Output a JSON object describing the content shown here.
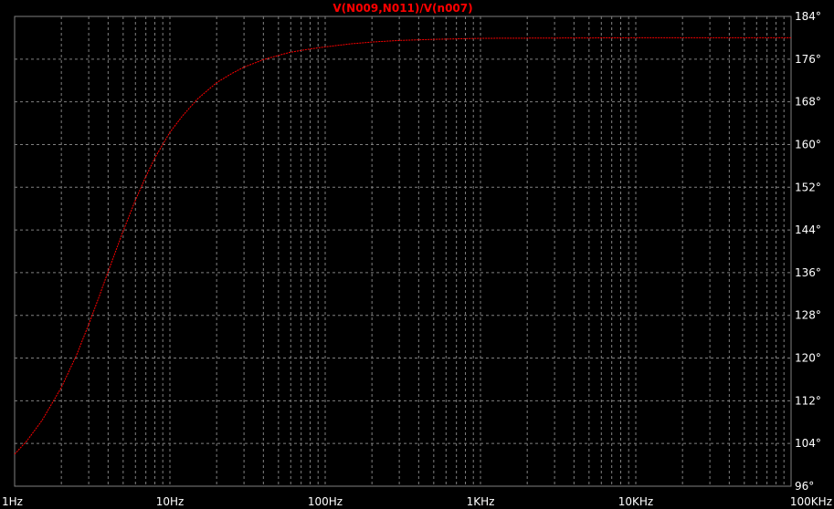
{
  "chart_data": {
    "type": "line",
    "title": "",
    "xlabel": "",
    "ylabel": "",
    "x_scale": "log",
    "xlim": [
      1,
      100000
    ],
    "ylim": [
      96,
      184
    ],
    "grid": true,
    "x_ticks": [
      1,
      10,
      100,
      1000,
      10000,
      100000
    ],
    "x_tick_labels": [
      "1Hz",
      "10Hz",
      "100Hz",
      "1KHz",
      "10KHz",
      "100KHz"
    ],
    "y_ticks": [
      96,
      104,
      112,
      120,
      128,
      136,
      144,
      152,
      160,
      168,
      176,
      184
    ],
    "y_tick_labels": [
      "96°",
      "104°",
      "112°",
      "120°",
      "128°",
      "136°",
      "144°",
      "152°",
      "160°",
      "168°",
      "176°",
      "184°"
    ],
    "series": [
      {
        "name": "V(N009,N011)/V(n007)",
        "color": "#ff0000",
        "x": [
          1,
          1.2,
          1.5,
          2,
          2.5,
          3,
          3.5,
          4,
          5,
          6,
          7,
          8,
          10,
          12,
          15,
          20,
          25,
          30,
          40,
          50,
          60,
          80,
          100,
          150,
          200,
          300,
          500,
          1000,
          10000,
          100000
        ],
        "y": [
          102,
          104.5,
          108.3,
          114.5,
          120.5,
          126.3,
          131.5,
          136.2,
          143.8,
          149.6,
          154,
          157.5,
          162.3,
          165.3,
          168.5,
          171.6,
          173.3,
          174.5,
          175.9,
          176.7,
          177.3,
          177.9,
          178.3,
          178.9,
          179.2,
          179.5,
          179.7,
          179.9,
          180,
          180
        ]
      }
    ]
  },
  "colors": {
    "background": "#000000",
    "grid": "#808080",
    "axis": "#808080",
    "tick_text": "#ffffff",
    "trace": "#ff0000"
  }
}
